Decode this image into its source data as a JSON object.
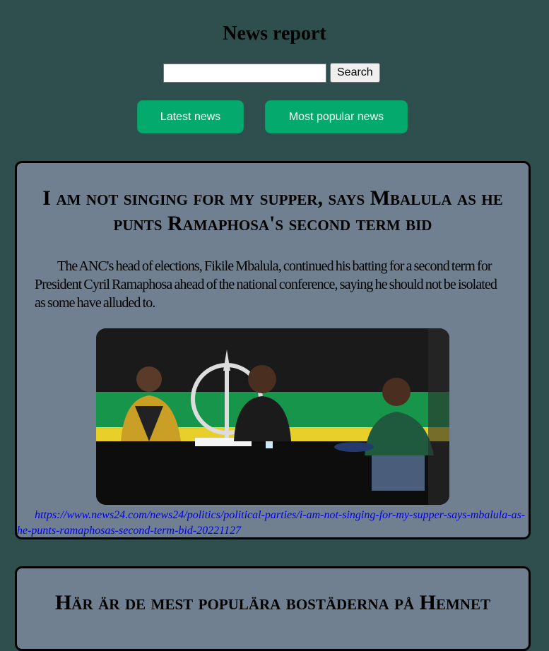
{
  "page": {
    "title": "News report"
  },
  "search": {
    "value": "",
    "placeholder": "",
    "button_label": "Search"
  },
  "nav": {
    "latest_label": "Latest news",
    "popular_label": "Most popular news"
  },
  "articles": [
    {
      "headline": "I am not singing for my supper, says Mbalula as he punts Ramaphosa's second term bid",
      "summary": "The ANC's head of elections, Fikile Mbalula, continued his batting for a second term for President Cyril Ramaphosa ahead of the national conference, saying he should not be isolated as some have alluded to.",
      "link": "https://www.news24.com/news24/politics/political-parties/i-am-not-singing-for-my-supper-says-mbalula-as-he-punts-ramaphosas-second-term-bid-20221127"
    },
    {
      "headline": "Här är de mest populära bostäderna på Hemnet"
    }
  ],
  "colors": {
    "background": "#2f4f4f",
    "card": "#708090",
    "button": "#04aa6d",
    "link": "#0000ee"
  }
}
